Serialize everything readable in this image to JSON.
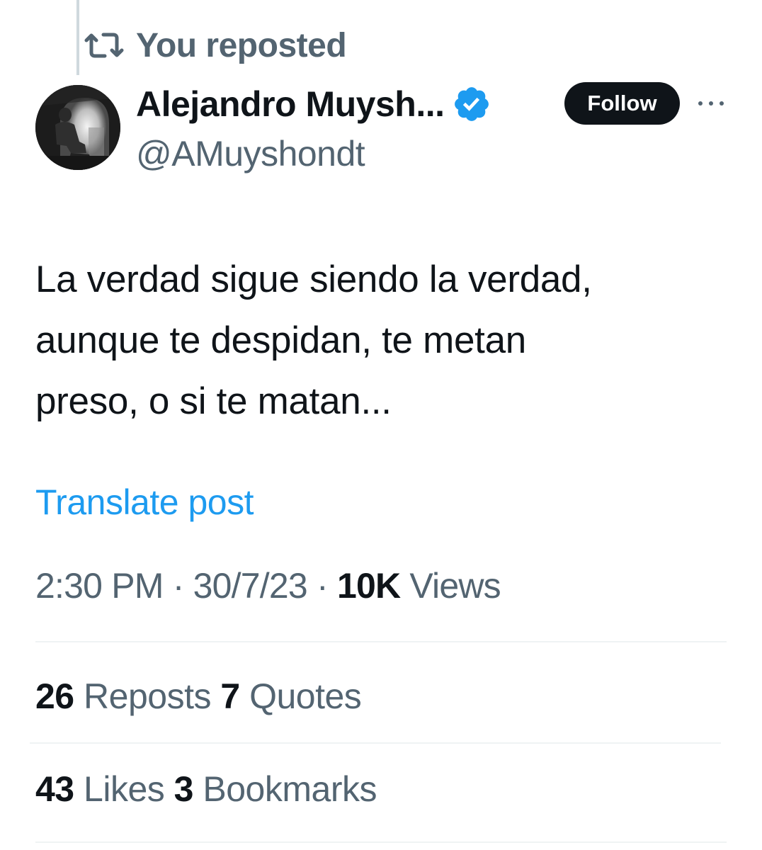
{
  "repost_context": {
    "label": "You reposted",
    "icon": "repost-icon"
  },
  "author": {
    "display_name": "Alejandro Muysh...",
    "handle": "@AMuyshondt",
    "verified_icon": "verified-badge-icon",
    "verified_color": "#1d9bf0"
  },
  "follow_button": {
    "label": "Follow"
  },
  "more_menu": {
    "icon": "more-icon"
  },
  "tweet": {
    "lines": [
      "La verdad sigue siendo la verdad,",
      "aunque te despidan, te metan",
      "preso, o si te matan..."
    ],
    "translate_label": "Translate post"
  },
  "meta": {
    "time": "2:30 PM",
    "separator": "·",
    "date": "30/7/23",
    "views_count": "10K",
    "views_label": "Views"
  },
  "stats": {
    "reposts_count": "26",
    "reposts_label": "Reposts",
    "quotes_count": "7",
    "quotes_label": "Quotes",
    "likes_count": "43",
    "likes_label": "Likes",
    "bookmarks_count": "3",
    "bookmarks_label": "Bookmarks"
  },
  "colors": {
    "text_primary": "#0f1419",
    "text_secondary": "#536471",
    "link": "#1d9bf0",
    "divider": "#eff3f4"
  }
}
